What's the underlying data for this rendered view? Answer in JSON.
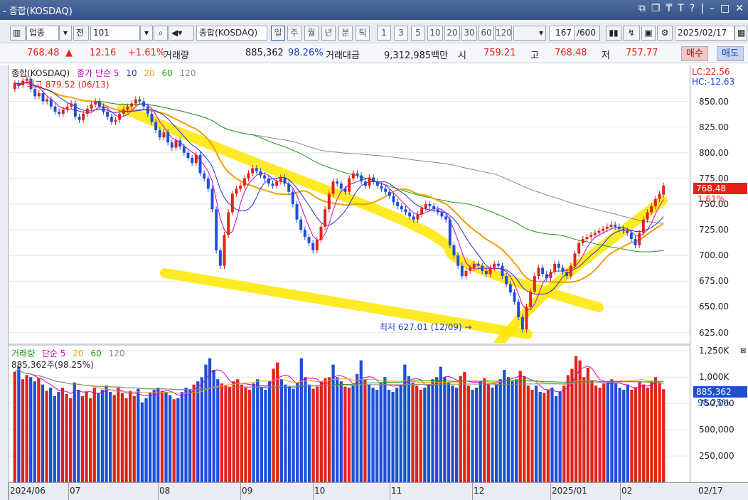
{
  "window": {
    "title": "- 종합(KOSDAQ)"
  },
  "toolbar": {
    "market": "업종",
    "jeon": "전",
    "code": "101",
    "name": "종합(KOSDAQ)",
    "periods": [
      "일",
      "주",
      "월",
      "년",
      "분",
      "틱"
    ],
    "active_period": "일",
    "intervals": [
      "1",
      "3",
      "5",
      "10",
      "20",
      "30",
      "60",
      "120"
    ],
    "count": "167",
    "count_total": "/600",
    "date": "2025/02/17"
  },
  "quote": {
    "price": "768.48",
    "arrow": "▲",
    "change": "12.16",
    "change_pct": "+1.61%",
    "volume_label": "거래량",
    "volume": "885,362",
    "volume_pct": "98.26%",
    "amount_label": "거래대금",
    "amount": "9,312,985백만",
    "open_label": "시",
    "open": "759.21",
    "high_label": "고",
    "high": "768.48",
    "low_label": "저",
    "low": "757.77",
    "buy": "매수",
    "sell": "매도"
  },
  "price_legend": {
    "name": "종합(KOSDAQ)",
    "ma_label": "종가 단순",
    "ma5": "5",
    "ma10": "10",
    "ma20": "20",
    "ma60": "60",
    "ma120": "120"
  },
  "annotations": {
    "high": "최고 879.52 (06/13)",
    "low": "최저 627.01 (12/09)",
    "lc": "LC:22.56",
    "hc": "HC:-12.63"
  },
  "price_tag": {
    "value": "768.48",
    "pct": "1.61%"
  },
  "vol_legend": {
    "label": "거래량",
    "ma_label": "단순",
    "ma5": "5",
    "ma20": "20",
    "ma60": "60",
    "ma120": "120",
    "current": "885,362주(98.25%)"
  },
  "vol_tag": {
    "value": "885,362",
    "pct": "98.25%"
  },
  "colors": {
    "up": "#e2231a",
    "down": "#1f4fd6",
    "ma5": "#d000d0",
    "ma10": "#1d2fd8",
    "ma20": "#f0a000",
    "ma60": "#1c9a1c",
    "ma120": "#8a8a8a",
    "highlight": "#ffe600"
  },
  "chart_data": [
    {
      "type": "candlestick",
      "title": "종합(KOSDAQ)",
      "y_ticks": [
        "850.00",
        "825.00",
        "800.00",
        "775.00",
        "750.00",
        "725.00",
        "700.00",
        "675.00",
        "650.00",
        "625.00"
      ],
      "ylim": [
        615,
        885
      ],
      "x_labels": [
        "2024/06",
        "07",
        "08",
        "09",
        "10",
        "11",
        "12",
        "2025/01",
        "02",
        "02/17"
      ],
      "series_close": [
        868,
        865,
        870,
        872,
        862,
        855,
        858,
        850,
        852,
        845,
        840,
        838,
        842,
        845,
        848,
        835,
        832,
        838,
        843,
        847,
        850,
        845,
        840,
        835,
        830,
        832,
        838,
        842,
        845,
        848,
        852,
        850,
        845,
        838,
        830,
        822,
        815,
        820,
        810,
        805,
        812,
        806,
        800,
        795,
        790,
        798,
        780,
        775,
        765,
        745,
        705,
        690,
        720,
        742,
        760,
        765,
        768,
        775,
        780,
        785,
        782,
        778,
        775,
        770,
        768,
        772,
        776,
        770,
        762,
        750,
        735,
        725,
        718,
        712,
        705,
        715,
        728,
        745,
        760,
        772,
        770,
        765,
        762,
        775,
        780,
        778,
        772,
        768,
        776,
        772,
        768,
        765,
        762,
        758,
        752,
        748,
        745,
        742,
        738,
        735,
        740,
        746,
        750,
        748,
        745,
        742,
        738,
        735,
        710,
        700,
        690,
        680,
        685,
        688,
        692,
        690,
        685,
        682,
        688,
        692,
        690,
        680,
        672,
        664,
        655,
        640,
        628,
        650,
        665,
        680,
        688,
        682,
        678,
        684,
        692,
        688,
        684,
        680,
        690,
        702,
        712,
        716,
        718,
        720,
        722,
        724,
        726,
        728,
        730,
        728,
        726,
        724,
        722,
        716,
        710,
        722,
        735,
        742,
        748,
        755,
        760,
        768
      ],
      "series_open": [
        862,
        868,
        866,
        870,
        872,
        862,
        855,
        858,
        850,
        852,
        845,
        840,
        838,
        842,
        845,
        848,
        835,
        832,
        838,
        843,
        847,
        850,
        845,
        840,
        835,
        830,
        832,
        838,
        842,
        845,
        848,
        852,
        850,
        845,
        838,
        830,
        822,
        815,
        820,
        810,
        805,
        812,
        806,
        800,
        795,
        790,
        798,
        780,
        775,
        765,
        745,
        705,
        690,
        720,
        742,
        760,
        765,
        768,
        775,
        780,
        785,
        782,
        778,
        775,
        770,
        768,
        772,
        776,
        770,
        762,
        750,
        735,
        725,
        718,
        712,
        705,
        715,
        728,
        745,
        760,
        772,
        770,
        765,
        762,
        775,
        780,
        778,
        772,
        768,
        776,
        772,
        768,
        765,
        762,
        758,
        752,
        748,
        745,
        742,
        738,
        735,
        740,
        746,
        750,
        748,
        745,
        742,
        738,
        735,
        710,
        700,
        690,
        680,
        685,
        688,
        692,
        690,
        685,
        682,
        688,
        692,
        690,
        680,
        672,
        664,
        655,
        640,
        628,
        650,
        665,
        680,
        688,
        682,
        678,
        684,
        692,
        688,
        684,
        680,
        690,
        702,
        712,
        716,
        718,
        720,
        722,
        724,
        726,
        728,
        730,
        728,
        726,
        724,
        722,
        716,
        710,
        722,
        735,
        742,
        748,
        755,
        759.21
      ]
    },
    {
      "type": "bar",
      "title": "거래량",
      "y_ticks": [
        "1,250K",
        "1,000K",
        "750,000",
        "500,000",
        "250,000"
      ],
      "ylim": [
        0,
        1300000
      ],
      "values": [
        1050000,
        1100000,
        980000,
        1020000,
        1000000,
        960000,
        990000,
        930000,
        870000,
        900000,
        820000,
        860000,
        900000,
        840000,
        800000,
        950000,
        880000,
        820000,
        860000,
        800000,
        900000,
        850000,
        880000,
        920000,
        860000,
        830000,
        900000,
        850000,
        800000,
        870000,
        820000,
        890000,
        760000,
        800000,
        850000,
        880000,
        900000,
        870000,
        860000,
        830000,
        790000,
        800000,
        860000,
        900000,
        880000,
        930000,
        960000,
        1000000,
        1120000,
        1180000,
        1070000,
        980000,
        940000,
        920000,
        910000,
        960000,
        980000,
        930000,
        900000,
        880000,
        940000,
        980000,
        900000,
        880000,
        960000,
        1080000,
        1140000,
        980000,
        930000,
        910000,
        890000,
        950000,
        1180000,
        1000000,
        930000,
        890000,
        910000,
        960000,
        990000,
        1000000,
        1120000,
        1000000,
        960000,
        910000,
        900000,
        920000,
        1030000,
        1160000,
        980000,
        930000,
        900000,
        880000,
        950000,
        1000000,
        880000,
        860000,
        900000,
        930000,
        1120000,
        1010000,
        950000,
        920000,
        880000,
        900000,
        930000,
        980000,
        1000000,
        1100000,
        1000000,
        950000,
        920000,
        900000,
        1010000,
        1050000,
        920000,
        880000,
        900000,
        960000,
        990000,
        940000,
        900000,
        930000,
        980000,
        1070000,
        1000000,
        960000,
        980000,
        1060000,
        1010000,
        920000,
        880000,
        920000,
        860000,
        850000,
        880000,
        900000,
        820000,
        860000,
        920000,
        1020000,
        1080000,
        1200000,
        1160000,
        1000000,
        1090000,
        970000,
        920000,
        900000,
        940000,
        960000,
        980000,
        940000,
        900000,
        880000,
        930000,
        880000,
        900000,
        960000,
        930000,
        900000,
        950000,
        1000000,
        950000,
        885362
      ]
    }
  ]
}
